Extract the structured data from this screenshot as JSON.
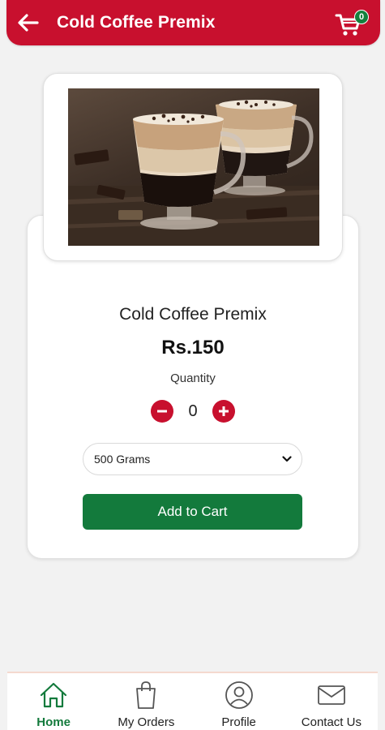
{
  "header": {
    "title": "Cold Coffee Premix",
    "back_icon": "arrow-left-icon",
    "cart_icon": "cart-icon",
    "cart_count": "0"
  },
  "product": {
    "name": "Cold Coffee Premix",
    "price": "Rs.150",
    "quantity_label": "Quantity",
    "quantity": "0",
    "selected_weight": "500 Grams",
    "add_to_cart_label": "Add to Cart"
  },
  "bottom_nav": {
    "items": [
      {
        "label": "Home",
        "icon": "home-icon",
        "active": true
      },
      {
        "label": "My Orders",
        "icon": "shopping-bag-icon",
        "active": false
      },
      {
        "label": "Profile",
        "icon": "profile-icon",
        "active": false
      },
      {
        "label": "Contact Us",
        "icon": "mail-icon",
        "active": false
      }
    ]
  },
  "colors": {
    "brand_red": "#c8102e",
    "brand_green": "#137a3c",
    "background": "#f2f2f2"
  }
}
